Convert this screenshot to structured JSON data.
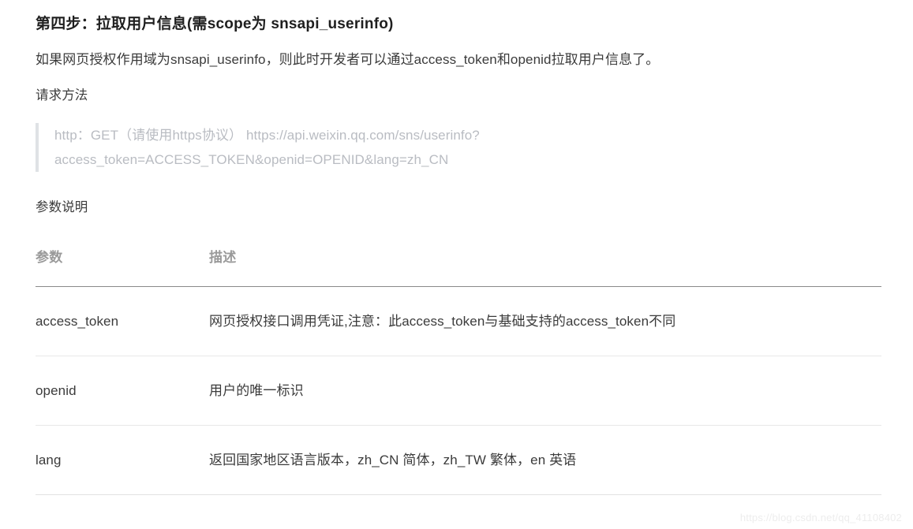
{
  "heading": "第四步：拉取用户信息(需scope为 snsapi_userinfo)",
  "intro_paragraph": "如果网页授权作用域为snsapi_userinfo，则此时开发者可以通过access_token和openid拉取用户信息了。",
  "request_method_label": "请求方法",
  "request_quote": {
    "line1": "http：GET（请使用https协议）  https://api.weixin.qq.com/sns/userinfo?",
    "line2": "access_token=ACCESS_TOKEN&openid=OPENID&lang=zh_CN"
  },
  "params_label": "参数说明",
  "table": {
    "headers": [
      "参数",
      "描述"
    ],
    "rows": [
      {
        "param": "access_token",
        "desc": "网页授权接口调用凭证,注意：此access_token与基础支持的access_token不同"
      },
      {
        "param": "openid",
        "desc": "用户的唯一标识"
      },
      {
        "param": "lang",
        "desc": "返回国家地区语言版本，zh_CN 简体，zh_TW 繁体，en 英语"
      }
    ]
  },
  "watermark": "https://blog.csdn.net/qq_41108402",
  "colors": {
    "heading": "#1f1f1f",
    "body_text": "#3b3b3b",
    "quote_text": "#b9bcc2",
    "quote_bar": "#dfe2e5",
    "table_header_text": "#9a9a9a",
    "header_rule": "#8a8a8a",
    "row_rule": "#e8e8e8",
    "watermark": "#ededed"
  }
}
